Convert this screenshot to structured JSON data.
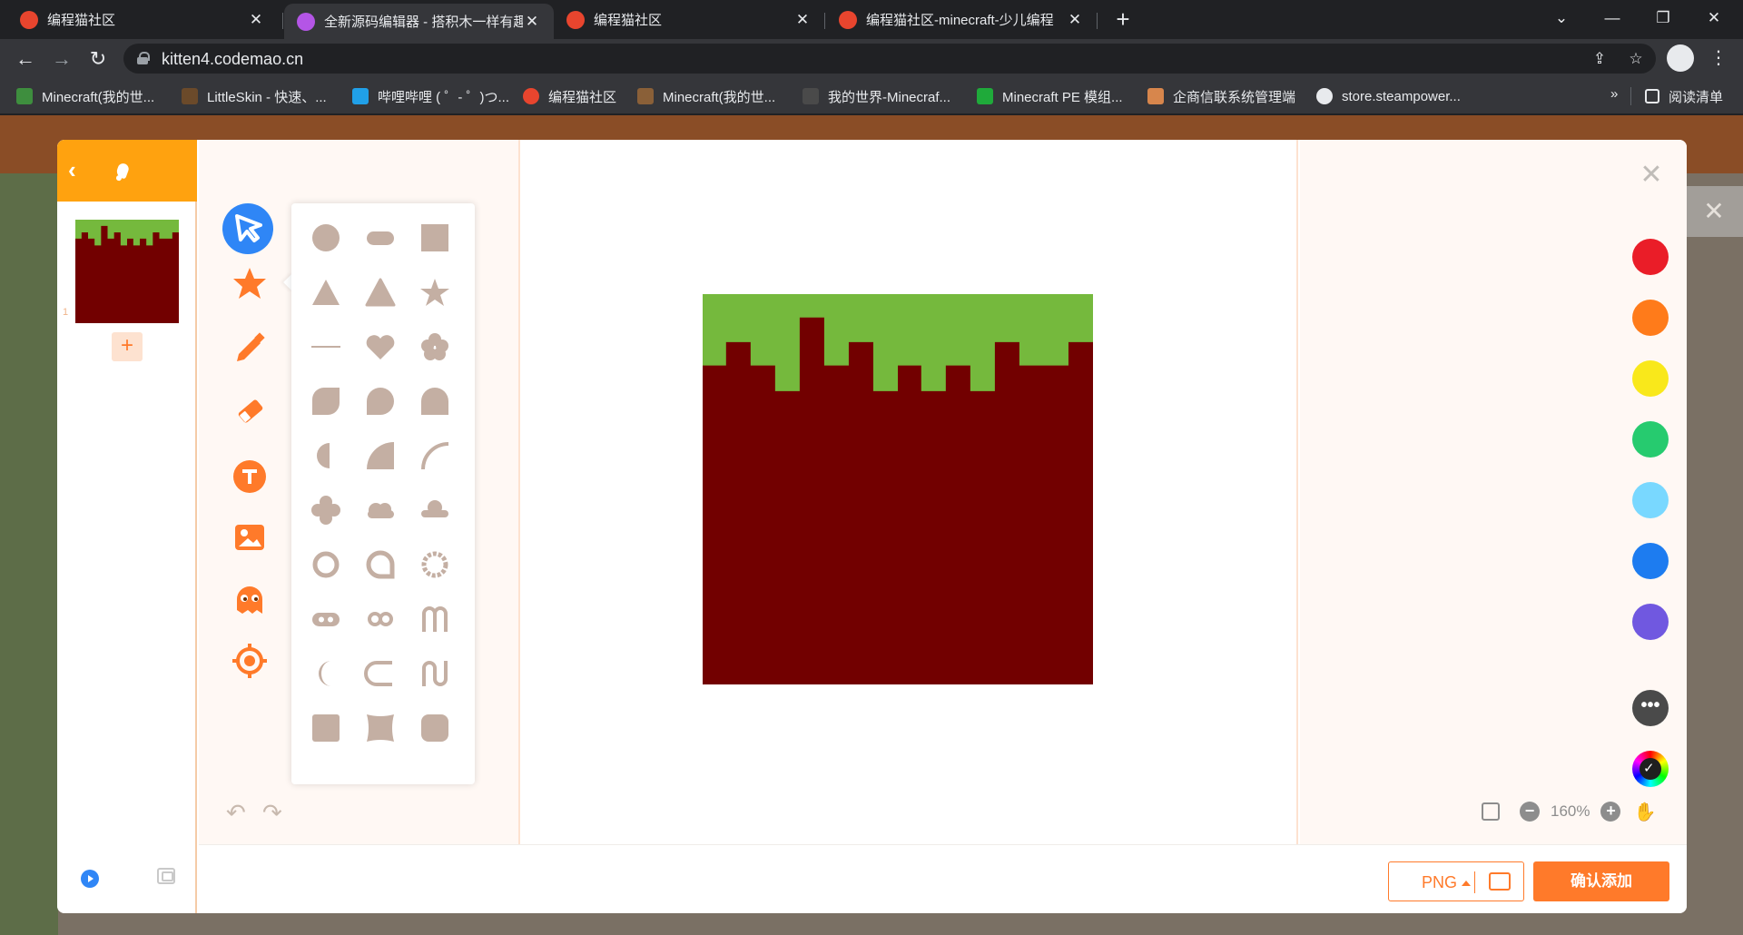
{
  "browser": {
    "tabs": [
      {
        "title": "编程猫社区",
        "active": false
      },
      {
        "title": "全新源码编辑器 - 搭积木一样有趣",
        "active": true
      },
      {
        "title": "编程猫社区",
        "active": false
      },
      {
        "title": "编程猫社区-minecraft-少儿编程",
        "active": false
      }
    ],
    "new_tab_label": "+",
    "url": "kitten4.codemao.cn",
    "bookmarks": [
      "Minecraft(我的世...",
      "LittleSkin - 快速、...",
      "哔哩哔哩 ( ゜- ゜)つ...",
      "编程猫社区",
      "Minecraft(我的世...",
      "我的世界-Minecraf...",
      "Minecraft PE 模组...",
      "企商信联系统管理端",
      "store.steampower..."
    ],
    "bookmarks_overflow": "»",
    "reading_list": "阅读清单"
  },
  "editor": {
    "frame_number": "1",
    "add_frame": "+",
    "zoom": "160%",
    "format": "PNG",
    "confirm": "确认添加",
    "colors": [
      "#ea1d28",
      "#ff7b1a",
      "#f9e81b",
      "#26cb6f",
      "#79d8ff",
      "#1d7cf0",
      "#7058e0"
    ],
    "more_colors": "•••",
    "custom_color_check": "✓",
    "drawing": {
      "background": "#720000",
      "grass": "#75b93d"
    }
  }
}
